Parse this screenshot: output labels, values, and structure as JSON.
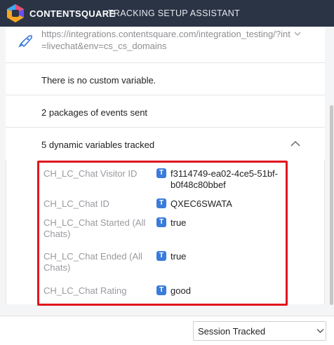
{
  "header": {
    "brand": "CONTENTSQUARE",
    "title": "TRACKING SETUP ASSISTANT"
  },
  "integration": {
    "url": "https://integrations.contentsquare.com/integration_testing/?int=livechat&env=cs_cs_domains"
  },
  "rows": {
    "custom_variable": "There is no custom variable.",
    "packages": "2 packages of events sent",
    "dynamic": "5 dynamic variables tracked"
  },
  "variables": [
    {
      "name": "CH_LC_Chat Visitor ID",
      "type": "T",
      "value": "f3114749-ea02-4ce5-51bf-b0f48c80bbef"
    },
    {
      "name": "CH_LC_Chat ID",
      "type": "T",
      "value": "QXEC6SWATA"
    },
    {
      "name": "CH_LC_Chat Started (All Chats)",
      "type": "T",
      "value": "true"
    },
    {
      "name": "CH_LC_Chat Ended (All Chats)",
      "type": "T",
      "value": "true"
    },
    {
      "name": "CH_LC_Chat Rating",
      "type": "T",
      "value": "good"
    }
  ],
  "footer": {
    "select_value": "Session Tracked"
  },
  "colors": {
    "topbar": "#2b3445",
    "highlight": "#e0161e",
    "badge": "#3a7bdb"
  }
}
